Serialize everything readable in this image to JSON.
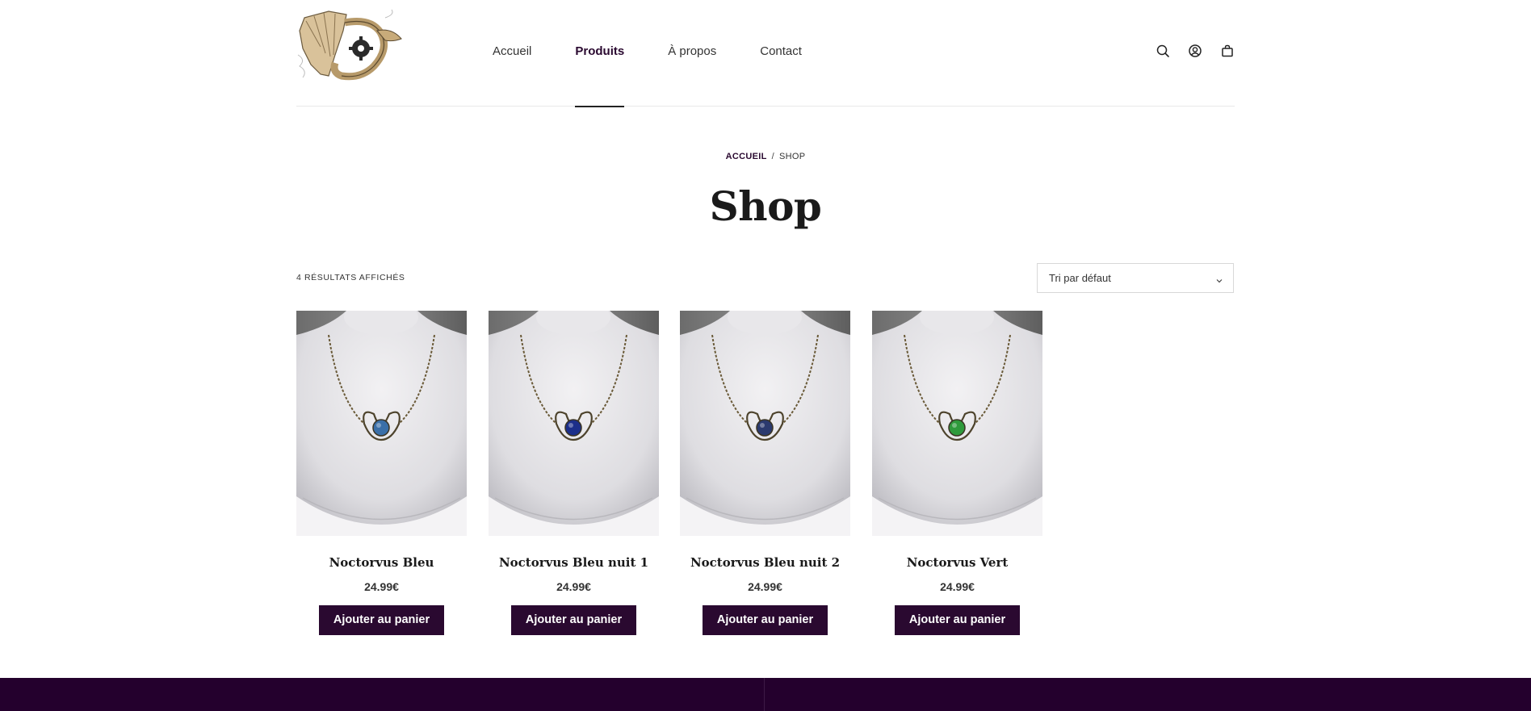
{
  "header": {
    "nav": [
      {
        "label": "Accueil",
        "active": false
      },
      {
        "label": "Produits",
        "active": true
      },
      {
        "label": "À propos",
        "active": false
      },
      {
        "label": "Contact",
        "active": false
      }
    ],
    "icons": [
      "search-icon",
      "account-icon",
      "cart-icon"
    ]
  },
  "breadcrumb": {
    "home": "ACCUEIL",
    "separator": "/",
    "current": "SHOP"
  },
  "page": {
    "title": "Shop"
  },
  "toolbar": {
    "result_count": "4 RÉSULTATS AFFICHÉS",
    "sort_selected": "Tri par défaut"
  },
  "products": [
    {
      "name": "Noctorvus Bleu",
      "price": "24.99€",
      "button": "Ajouter au panier",
      "stone_color": "#3a6fa8"
    },
    {
      "name": "Noctorvus Bleu nuit 1",
      "price": "24.99€",
      "button": "Ajouter au panier",
      "stone_color": "#1c2f8a"
    },
    {
      "name": "Noctorvus Bleu nuit 2",
      "price": "24.99€",
      "button": "Ajouter au panier",
      "stone_color": "#2b3a6e"
    },
    {
      "name": "Noctorvus Vert",
      "price": "24.99€",
      "button": "Ajouter au panier",
      "stone_color": "#2f9a3c"
    }
  ],
  "colors": {
    "accent": "#2a0930",
    "footer": "#24002d"
  }
}
